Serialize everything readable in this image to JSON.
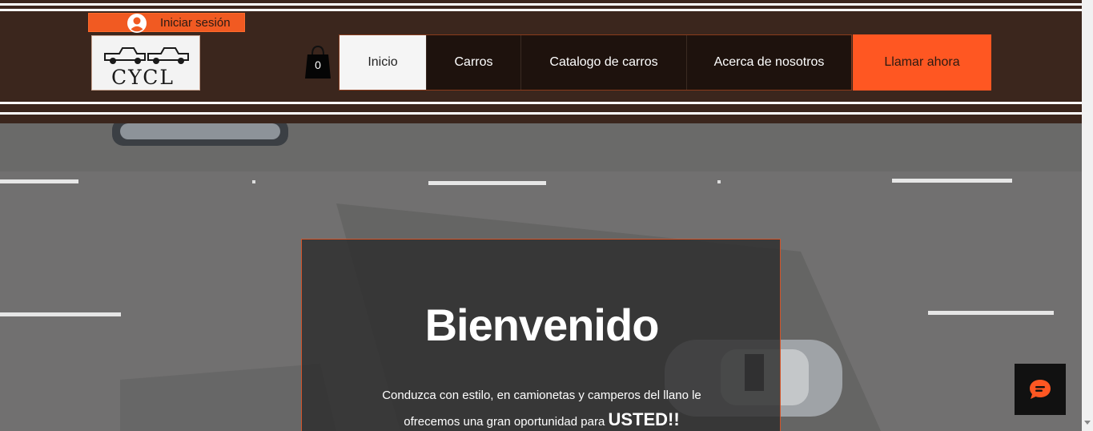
{
  "header": {
    "login_label": "Iniciar sesión",
    "logo_text": "CYCL",
    "cart_count": "0",
    "nav": [
      {
        "label": "Inicio",
        "active": true
      },
      {
        "label": "Carros",
        "active": false
      },
      {
        "label": "Catalogo de carros",
        "active": false
      },
      {
        "label": "Acerca de nosotros",
        "active": false
      }
    ],
    "cta_label": "Llamar ahora"
  },
  "hero": {
    "title": "Bienvenido",
    "line1": "Conduzca con estilo, en camionetas y camperos del llano le",
    "line2_prefix": "ofrecemos una gran oportunidad para",
    "line2_strong": "USTED!!"
  },
  "icons": {
    "avatar": "user-avatar-icon",
    "cart": "shopping-bag-icon",
    "chat": "chat-bubble-icon"
  },
  "colors": {
    "header_bg": "#3b261d",
    "accent": "#ff5722",
    "nav_bg": "#1e120d",
    "panel_border": "#d2542a"
  }
}
